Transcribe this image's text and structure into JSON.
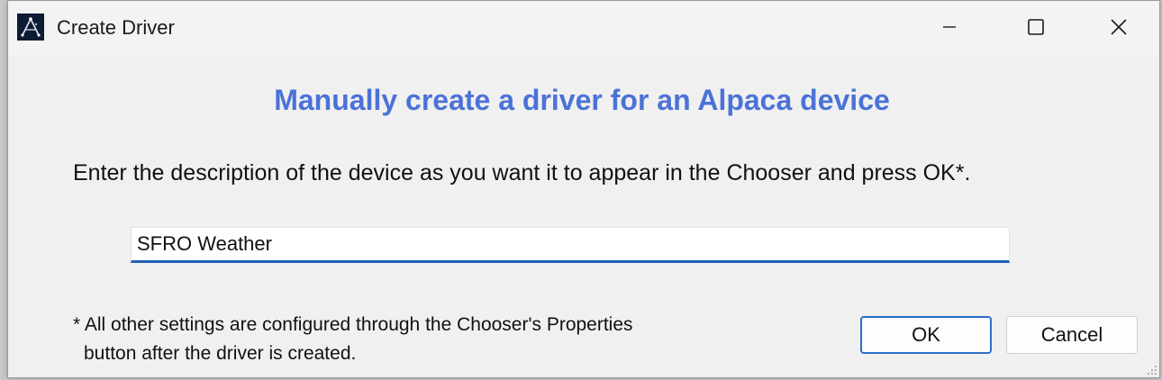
{
  "window": {
    "title": "Create Driver"
  },
  "dialog": {
    "heading": "Manually create a driver for an Alpaca device",
    "instruction": "Enter the description of the device as you want it to appear in the Chooser and press OK*.",
    "description_value": "SFRO Weather",
    "footnote_line1": "* All other settings are configured through the Chooser's Properties",
    "footnote_line2": "button after the driver is created.",
    "ok_label": "OK",
    "cancel_label": "Cancel"
  },
  "colors": {
    "heading": "#4b72d8",
    "input_accent": "#1f5fb2",
    "ok_border": "#2d6ec7"
  },
  "icons": {
    "app": "ascom-app-icon",
    "minimize": "minimize-icon",
    "maximize": "maximize-icon",
    "close": "close-icon",
    "grip": "resize-grip-icon"
  }
}
